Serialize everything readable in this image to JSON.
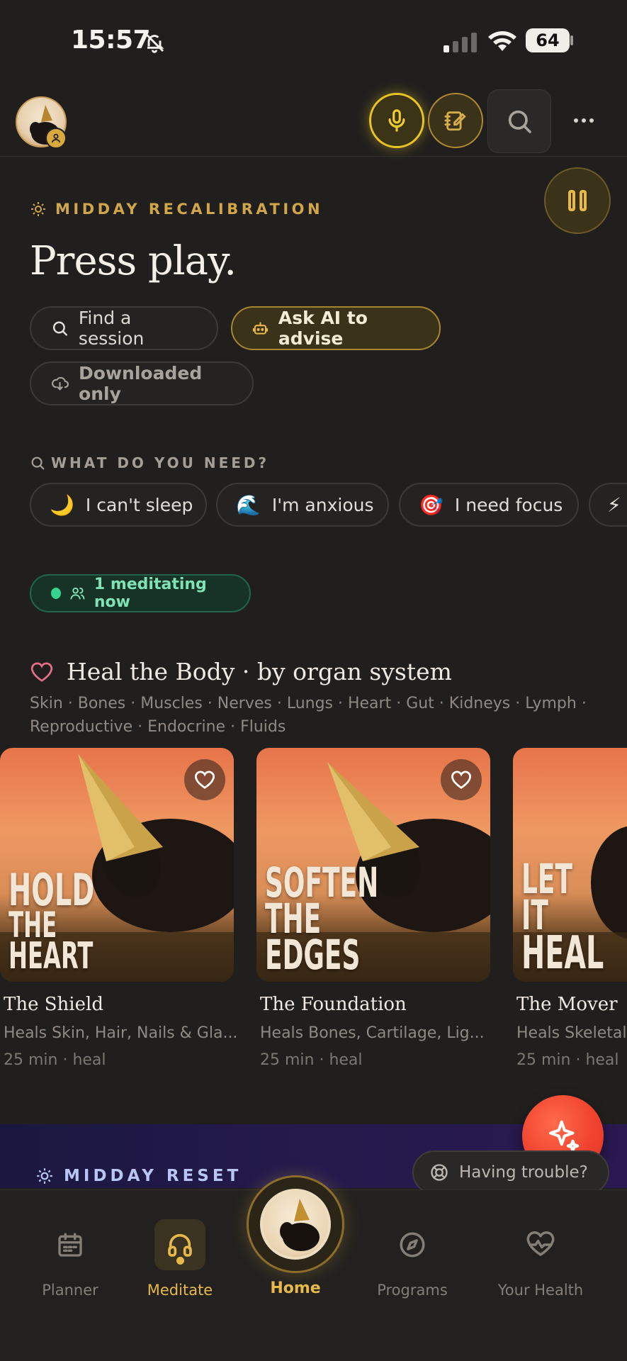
{
  "status_bar": {
    "time": "15:57",
    "battery": "64"
  },
  "hero": {
    "kicker": "MIDDAY RECALIBRATION",
    "title": "Press play.",
    "find_label": "Find a session",
    "ai_label": "Ask AI to advise",
    "downloaded_label": "Downloaded only"
  },
  "needs": {
    "heading": "WHAT DO YOU NEED?",
    "items": [
      {
        "emoji": "🌙",
        "label": "I can't sleep"
      },
      {
        "emoji": "🌊",
        "label": "I'm anxious"
      },
      {
        "emoji": "🎯",
        "label": "I need focus"
      },
      {
        "emoji": "⚡",
        "label": ""
      }
    ]
  },
  "live": {
    "label": "1 meditating now"
  },
  "heal": {
    "title": "Heal the Body · by organ system",
    "subtitle": "Skin · Bones · Muscles · Nerves · Lungs · Heart · Gut · Kidneys · Lymph · Reproductive · Endocrine · Fluids",
    "cards": [
      {
        "art_text_1": "HOLD",
        "art_text_2": "THE",
        "art_text_3": "HEART",
        "title": "The Shield",
        "desc": "Heals Skin, Hair, Nails & Gla...",
        "meta": "25 min · heal"
      },
      {
        "art_text_1": "SOFTEN",
        "art_text_2": "THE EDGES",
        "art_text_3": "",
        "title": "The Foundation",
        "desc": "Heals Bones, Cartilage, Lig...",
        "meta": "25 min · heal"
      },
      {
        "art_text_1": "LET IT",
        "art_text_2": "HEAL",
        "art_text_3": "",
        "title": "The Mover",
        "desc": "Heals Skeletal",
        "meta": "25 min · heal"
      }
    ]
  },
  "reset": {
    "label": "MIDDAY RESET"
  },
  "help": {
    "label": "Having trouble?"
  },
  "nav": {
    "planner": "Planner",
    "meditate": "Meditate",
    "home": "Home",
    "programs": "Programs",
    "health": "Your Health"
  },
  "colors": {
    "accent": "#e7b84a",
    "live": "#35d38e",
    "fab": "#f0432f"
  }
}
